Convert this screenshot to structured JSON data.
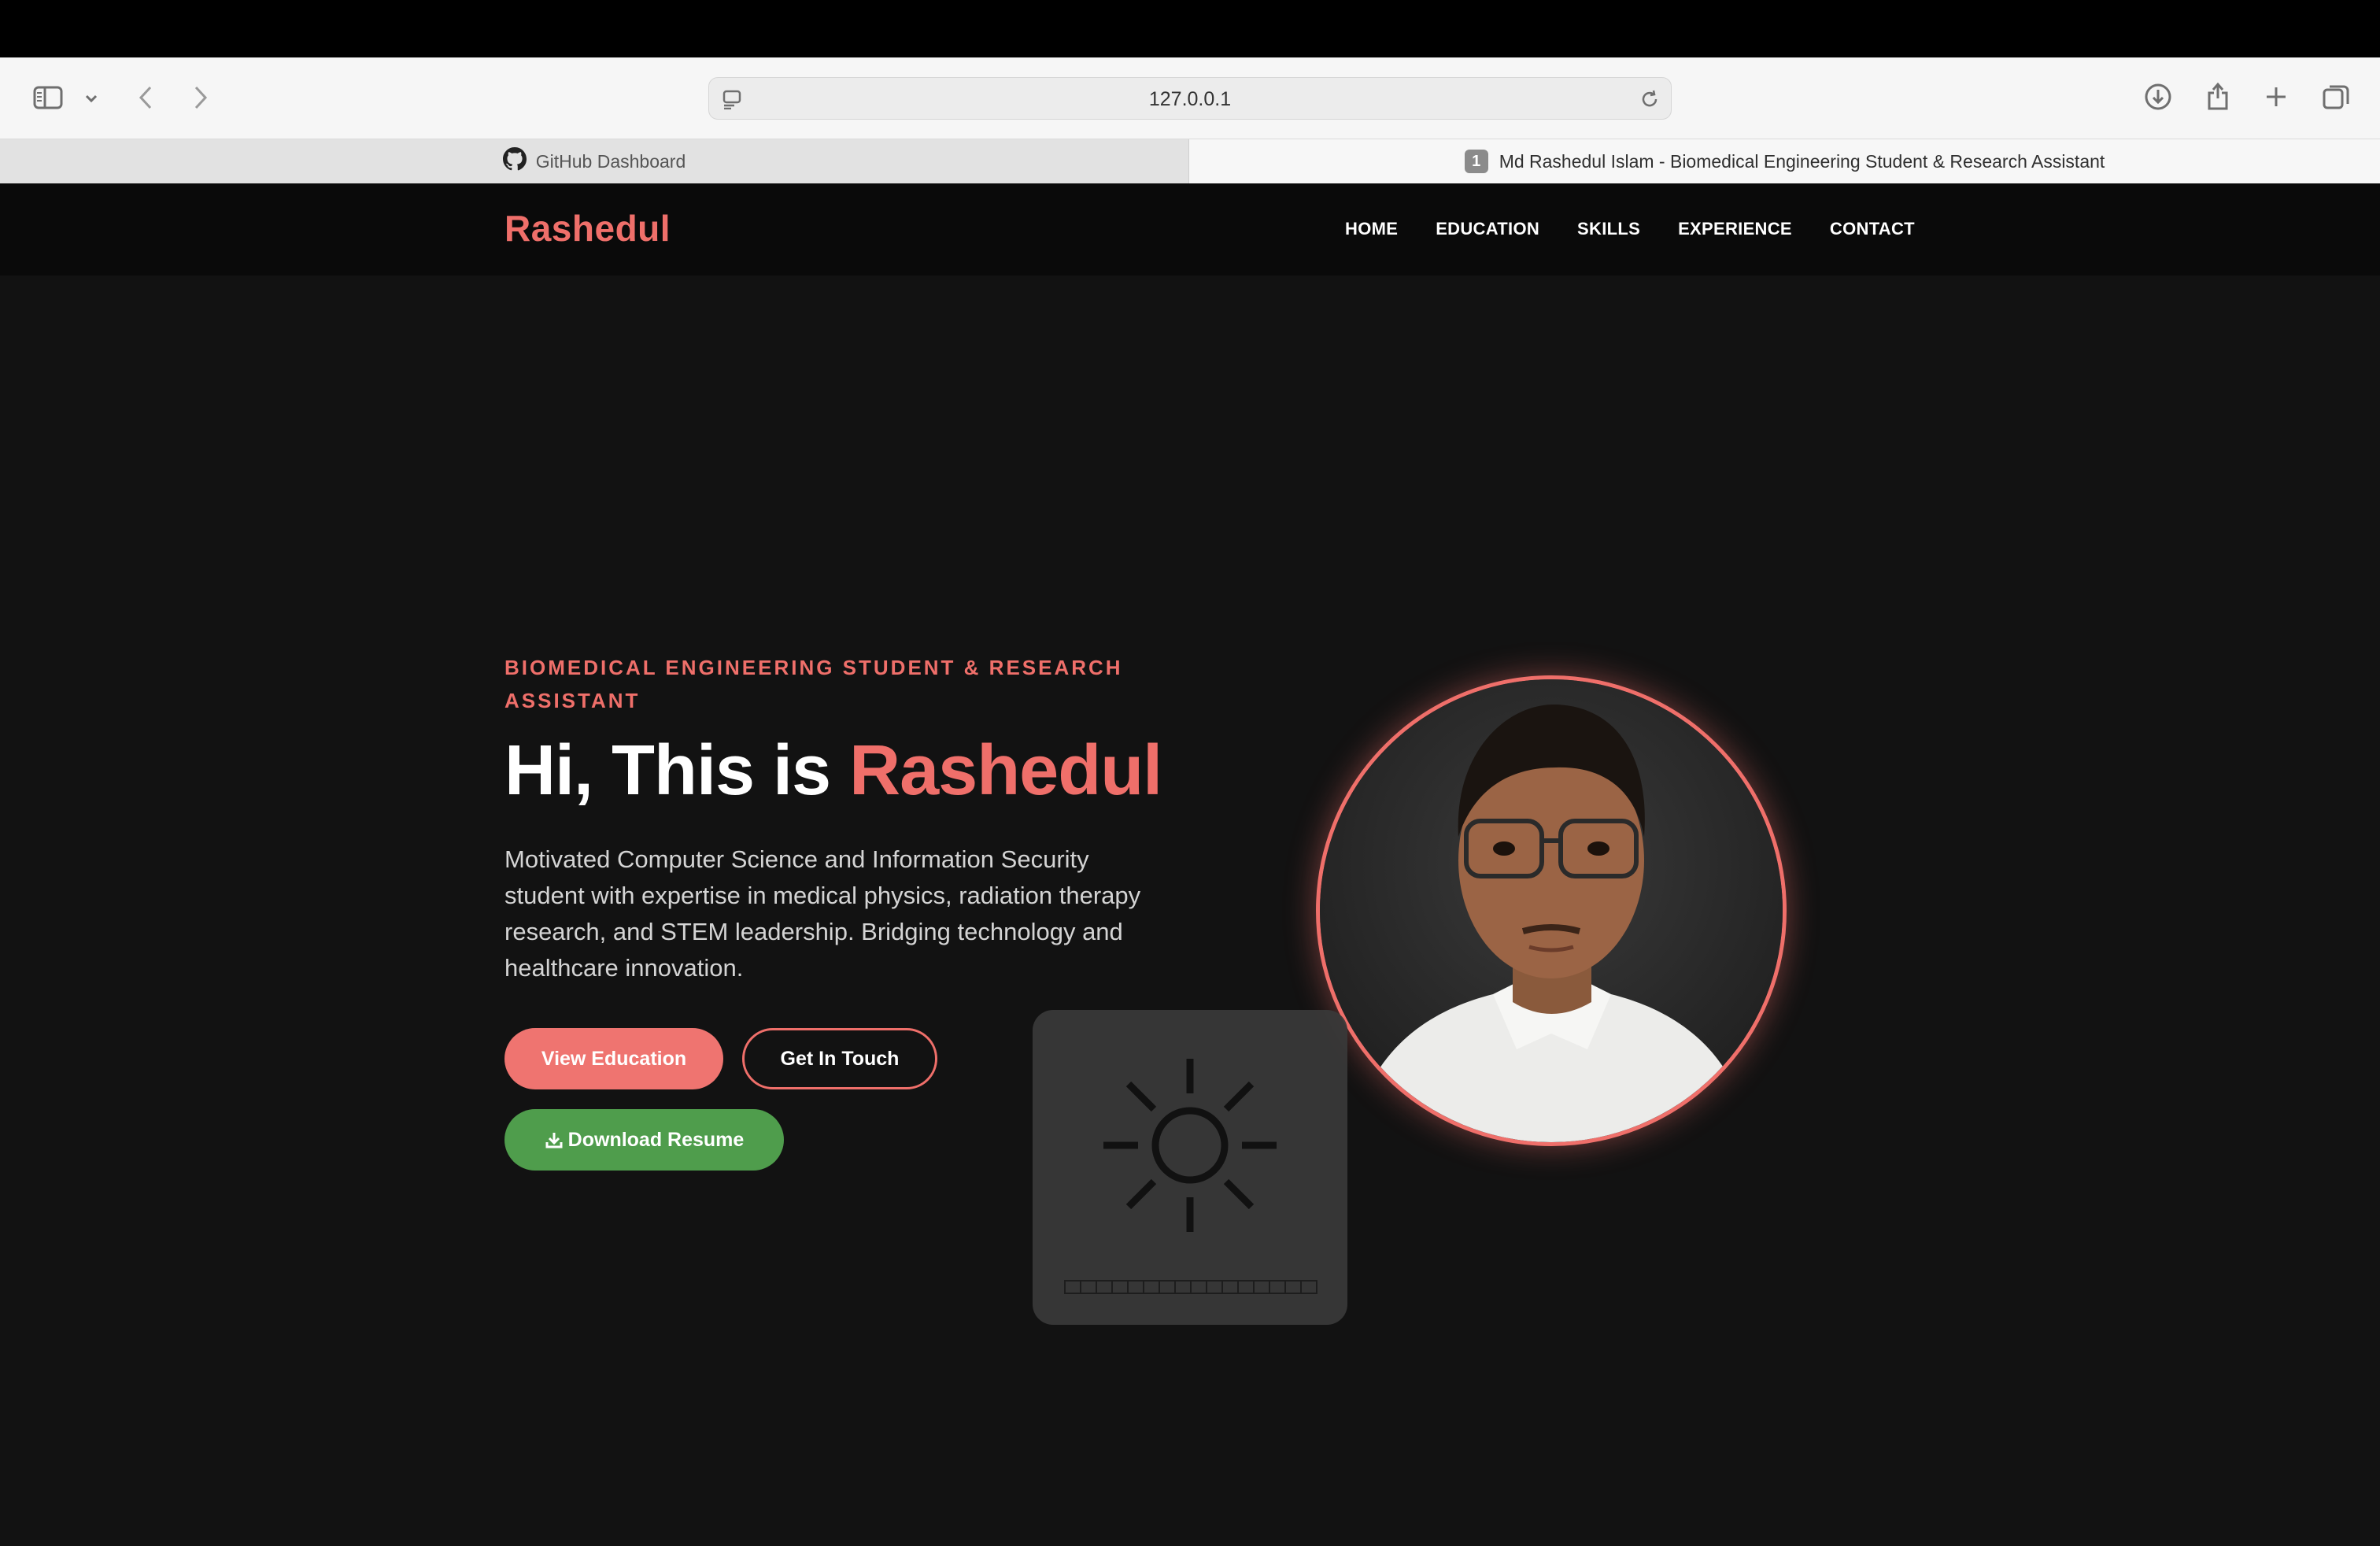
{
  "browser": {
    "url": "127.0.0.1",
    "tabs": [
      {
        "label": "GitHub Dashboard",
        "active": false,
        "icon": "github-icon"
      },
      {
        "label": "Md Rashedul Islam - Biomedical Engineering Student & Research Assistant",
        "active": true,
        "badge": "1"
      }
    ],
    "icons": [
      "sidebar-icon",
      "chevron-down-icon",
      "back-icon",
      "forward-icon",
      "reader-icon",
      "reload-icon",
      "download-icon",
      "share-icon",
      "new-tab-icon",
      "tab-overview-icon"
    ]
  },
  "nav": {
    "brand": "Rashedul",
    "links": [
      "HOME",
      "EDUCATION",
      "SKILLS",
      "EXPERIENCE",
      "CONTACT"
    ]
  },
  "hero": {
    "eyebrow": "BIOMEDICAL ENGINEERING STUDENT & RESEARCH ASSISTANT",
    "headline_prefix": "Hi, This is ",
    "headline_name": "Rashedul",
    "description": "Motivated Computer Science and Information Security student with expertise in medical physics, radiation therapy research, and STEM leadership. Bridging technology and healthcare innovation.",
    "buttons": {
      "view_education": "View Education",
      "get_in_touch": "Get In Touch",
      "download_resume": "Download Resume"
    }
  },
  "overlay": {
    "icon": "brightness-sun-icon",
    "level": 0
  },
  "colors": {
    "accent": "#ef6f6a",
    "background": "#121212",
    "green": "#4f9d4c"
  }
}
